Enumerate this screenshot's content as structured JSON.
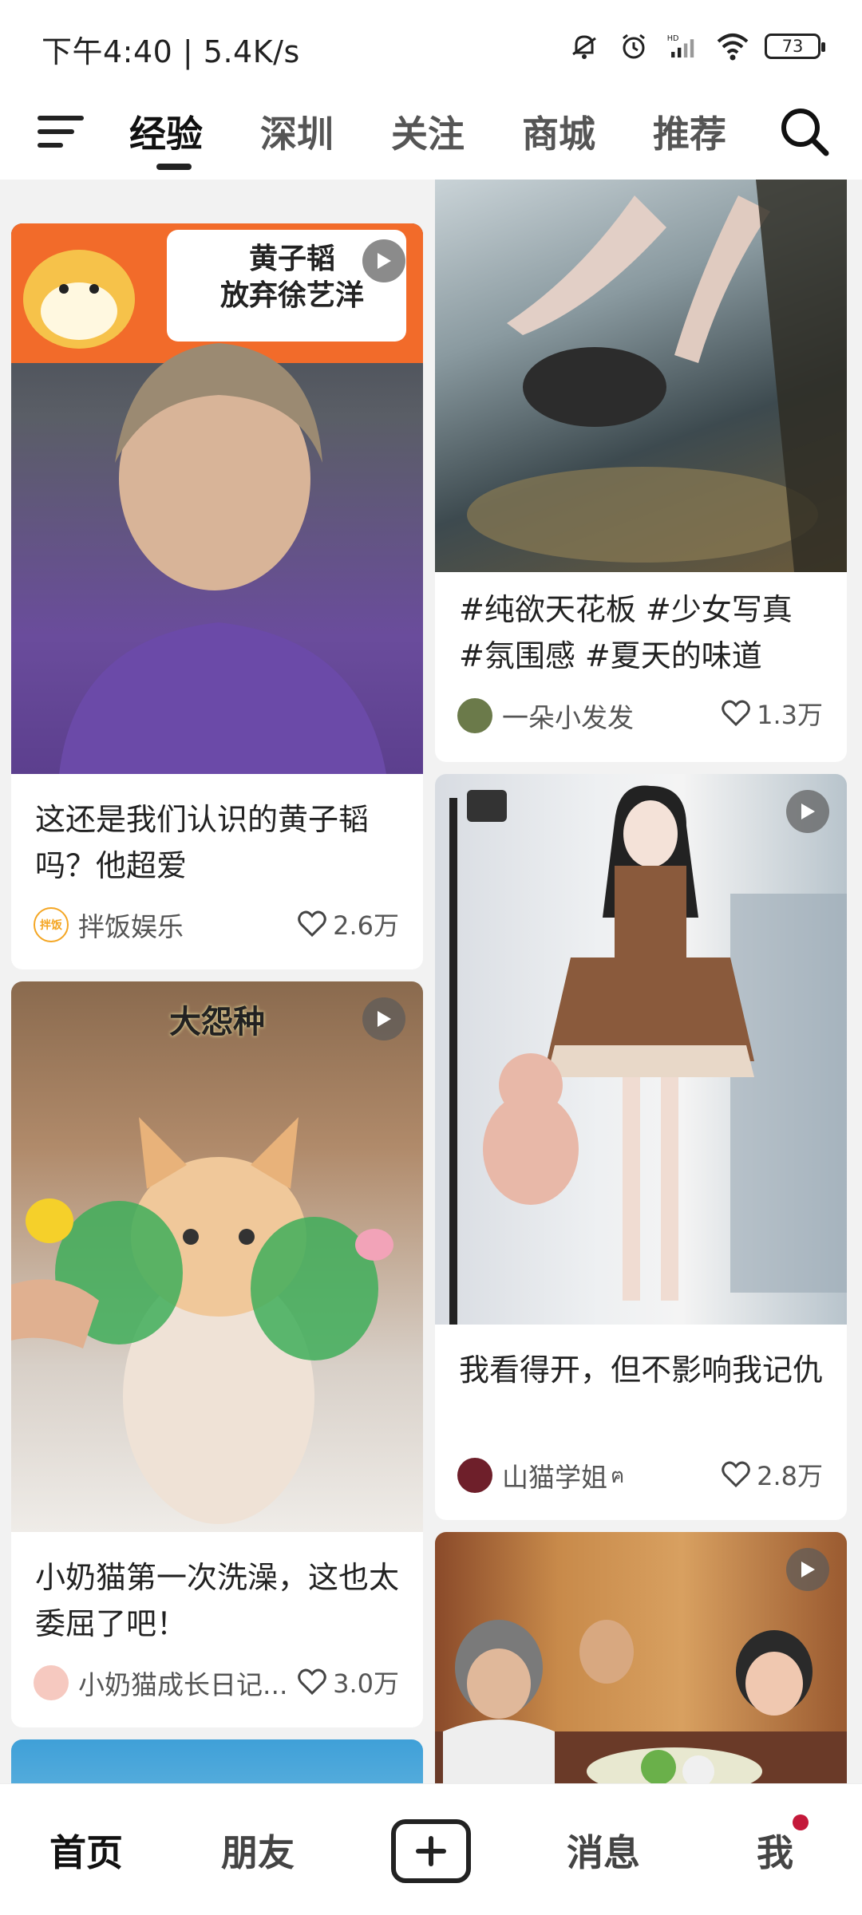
{
  "status": {
    "time_speed": "下午4:40 | 5.4K/s",
    "battery": "73",
    "icons": [
      "mute-bell-icon",
      "alarm-icon",
      "hd-signal-icon",
      "wifi-icon",
      "battery-icon"
    ]
  },
  "topbar": {
    "tabs": [
      {
        "label": "经验",
        "active": true
      },
      {
        "label": "深圳",
        "active": false
      },
      {
        "label": "关注",
        "active": false
      },
      {
        "label": "商城",
        "active": false
      },
      {
        "label": "推荐",
        "active": false
      }
    ]
  },
  "feed": {
    "cards": [
      {
        "title": "这还是我们认识的黄子韬吗？他超爱",
        "author": "拌饭娱乐",
        "avatar_text": "拌饭",
        "likes": "2.6万",
        "overlay_text": [
          "黄子韬",
          "放弃徐艺洋"
        ],
        "video": true
      },
      {
        "title": "#纯欲天花板 #少女写真 #氛围感 #夏天的味道",
        "author": "一朵小发发",
        "likes": "1.3万",
        "video": false
      },
      {
        "title": "小奶猫第一次洗澡，这也太委屈了吧！",
        "author": "小奶猫成长日记...",
        "likes": "3.0万",
        "overlay_text": [
          "大怨种"
        ],
        "video": true
      },
      {
        "title": "我看得开，但不影响我记仇",
        "author": "山猫学姐",
        "author_suffix": "ฅ",
        "likes": "2.8万",
        "video": true
      },
      {
        "title": "",
        "author": "",
        "likes": "",
        "video": true
      }
    ]
  },
  "bottomnav": {
    "items": [
      {
        "label": "首页",
        "active": true
      },
      {
        "label": "朋友",
        "active": false
      },
      {
        "label": "消息",
        "active": false
      },
      {
        "label": "我",
        "active": false
      }
    ]
  },
  "colors": {
    "background": "#f2f2f2",
    "card": "#ffffff",
    "badge": "#c4193a",
    "banner_orange": "#f26b2a"
  }
}
